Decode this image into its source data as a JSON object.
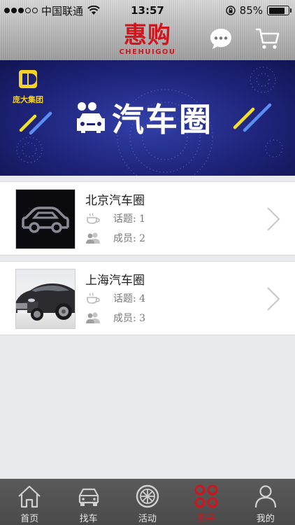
{
  "status_bar": {
    "carrier": "中国联通",
    "time": "13:57",
    "battery": "85%",
    "battery_level": 0.85,
    "signal_bars": 3
  },
  "header": {
    "logo_main": "惠购",
    "logo_sub": "CHEHUIGOU",
    "icons": [
      "chat-bubble-icon",
      "cart-icon"
    ]
  },
  "banner": {
    "brand_name": "庞大集团",
    "title": "汽车圈"
  },
  "circles": [
    {
      "name": "北京汽车圈",
      "topics_label": "话题: 1",
      "members_label": "成员: 2",
      "thumbnail": "car-outline-icon"
    },
    {
      "name": "上海汽车圈",
      "topics_label": "话题: 4",
      "members_label": "成员: 3",
      "thumbnail": "car-photo"
    }
  ],
  "tabbar": {
    "tabs": [
      {
        "label": "首页",
        "icon": "home-icon"
      },
      {
        "label": "找车",
        "icon": "car-icon"
      },
      {
        "label": "活动",
        "icon": "wheel-icon"
      },
      {
        "label": "圈子",
        "icon": "circles-icon"
      },
      {
        "label": "我的",
        "icon": "person-icon"
      }
    ],
    "active_index": 3
  },
  "colors": {
    "accent": "#d4141c",
    "banner_bg": "#1d2277",
    "tabbar_bg": "#4e4e4e",
    "brand_yellow": "#f6d326"
  }
}
